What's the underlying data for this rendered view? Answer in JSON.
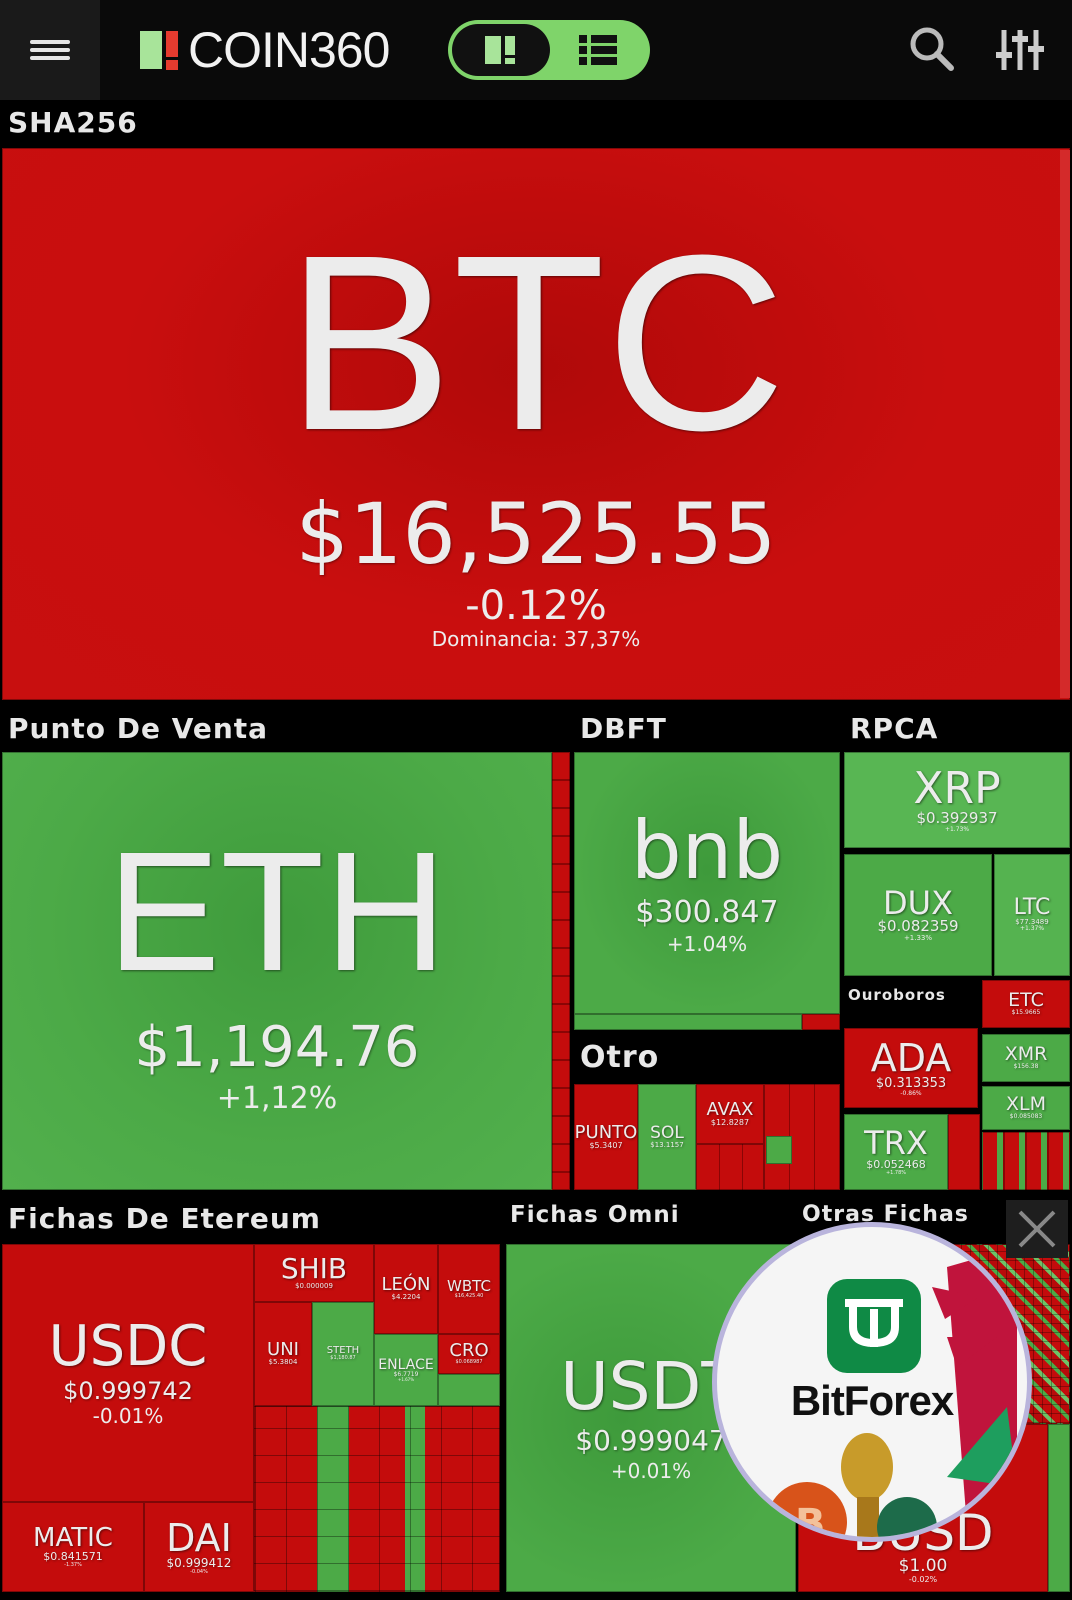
{
  "header": {
    "logo_text": "COIN360",
    "view_modes": [
      "grid",
      "list"
    ],
    "active_view": "grid",
    "icons": [
      "hamburger-menu-icon",
      "search-icon",
      "sliders-icon"
    ]
  },
  "colors": {
    "negative": "#c40c0c",
    "positive": "#4caa47",
    "background": "#000000",
    "brand_accent": "#7fd46a"
  },
  "sections": {
    "sha256": "SHA256",
    "pos": "Punto De Venta",
    "dbft": "DBFT",
    "rpca": "RPCA",
    "otro": "Otro",
    "ouroboros": "Ouroboros",
    "eth_tokens": "Fichas De Etereum",
    "omni": "Fichas Omni",
    "other": "Otras Fichas"
  },
  "coins": {
    "btc": {
      "symbol": "BTC",
      "price": "$16,525.55",
      "change": "-0.12%",
      "dominance": "Dominancia: 37,37%"
    },
    "eth": {
      "symbol": "ETH",
      "price": "$1,194.76",
      "change": "+1,12%"
    },
    "bnb": {
      "symbol": "bnb",
      "price": "$300.847",
      "change": "+1.04%"
    },
    "xrp": {
      "symbol": "XRP",
      "price": "$0.392937",
      "change": "+1.73%"
    },
    "dux": {
      "symbol": "DUX",
      "price": "$0.082359",
      "change": "+1.33%"
    },
    "ltc": {
      "symbol": "LTC",
      "price": "$77.3489",
      "change": "+1.37%"
    },
    "etc": {
      "symbol": "ETC",
      "price": "$15.9665"
    },
    "ada": {
      "symbol": "ADA",
      "price": "$0.313353",
      "change": "-0.86%"
    },
    "xmr": {
      "symbol": "XMR",
      "price": "$156.38"
    },
    "xlm": {
      "symbol": "XLM",
      "price": "$0.085083"
    },
    "trx": {
      "symbol": "TRX",
      "price": "$0.052468",
      "change": "+1.78%"
    },
    "dot": {
      "symbol": "PUNTO",
      "price": "$5.3407"
    },
    "sol": {
      "symbol": "SOL",
      "price": "$13.1157"
    },
    "avax": {
      "symbol": "AVAX",
      "price": "$12.8287"
    },
    "usdc": {
      "symbol": "USDC",
      "price": "$0.999742",
      "change": "-0.01%"
    },
    "shib": {
      "symbol": "SHIB",
      "price": "$0.000009"
    },
    "leo": {
      "symbol": "LEÓN",
      "price": "$4.2204"
    },
    "wbtc": {
      "symbol": "WBTC",
      "price": "$16,425.40"
    },
    "uni": {
      "symbol": "UNI",
      "price": "$5.3804"
    },
    "steth": {
      "symbol": "STETH",
      "price": "$1,180.87"
    },
    "link": {
      "symbol": "ENLACE",
      "price": "$6.7719",
      "change": "+1.67%"
    },
    "cro": {
      "symbol": "CRO",
      "price": "$0.068987"
    },
    "matic": {
      "symbol": "MATIC",
      "price": "$0.841571",
      "change": "-1.37%"
    },
    "dai": {
      "symbol": "DAI",
      "price": "$0.999412",
      "change": "-0.04%"
    },
    "usdt": {
      "symbol": "USDT",
      "price": "$0.999047",
      "change": "+0.01%"
    },
    "busd": {
      "symbol": "BUSD",
      "price": "$1.00",
      "change": "-0.02%"
    }
  },
  "ad": {
    "brand": "BitForex"
  }
}
